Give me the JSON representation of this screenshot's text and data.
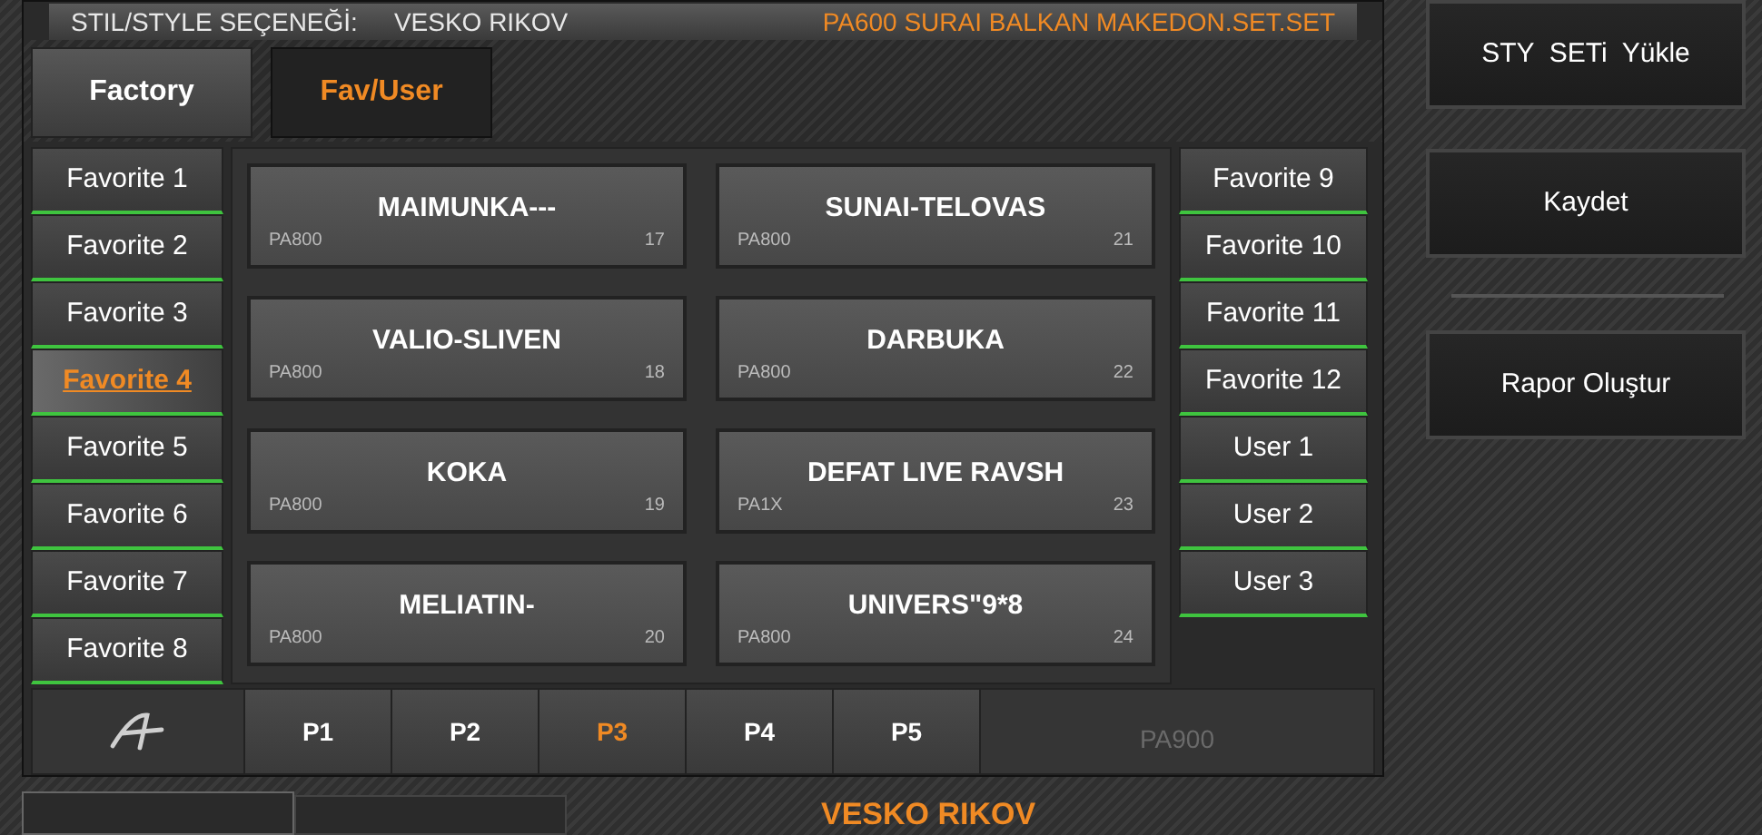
{
  "header": {
    "label": "STIL/STYLE SEÇENEĞİ:",
    "name": "VESKO RIKOV",
    "set_name": "PA600 SURAI BALKAN MAKEDON.SET.SET"
  },
  "tabs": [
    {
      "label": "Factory",
      "selected": false
    },
    {
      "label": "Fav/User",
      "selected": true
    }
  ],
  "left_banks": [
    {
      "label": "Favorite 1",
      "selected": false
    },
    {
      "label": "Favorite 2",
      "selected": false
    },
    {
      "label": "Favorite 3",
      "selected": false
    },
    {
      "label": "Favorite 4",
      "selected": true
    },
    {
      "label": "Favorite 5",
      "selected": false
    },
    {
      "label": "Favorite 6",
      "selected": false
    },
    {
      "label": "Favorite 7",
      "selected": false
    },
    {
      "label": "Favorite 8",
      "selected": false
    }
  ],
  "styles": [
    {
      "name": "MAIMUNKA---",
      "model": "PA800",
      "number": "17"
    },
    {
      "name": "SUNAI-TELOVAS",
      "model": "PA800",
      "number": "21"
    },
    {
      "name": "VALIO-SLIVEN",
      "model": "PA800",
      "number": "18"
    },
    {
      "name": "DARBUKA",
      "model": "PA800",
      "number": "22"
    },
    {
      "name": "KOKA",
      "model": "PA800",
      "number": "19"
    },
    {
      "name": "DEFAT LIVE RAVSH",
      "model": "PA1X",
      "number": "23"
    },
    {
      "name": "MELIATIN-",
      "model": "PA800",
      "number": "20"
    },
    {
      "name": "UNIVERS\"9*8",
      "model": "PA800",
      "number": "24"
    }
  ],
  "right_banks": [
    {
      "label": "Favorite 9",
      "selected": false
    },
    {
      "label": "Favorite 10",
      "selected": false
    },
    {
      "label": "Favorite 11",
      "selected": false
    },
    {
      "label": "Favorite 12",
      "selected": false
    },
    {
      "label": "User 1",
      "selected": false
    },
    {
      "label": "User 2",
      "selected": false
    },
    {
      "label": "User 3",
      "selected": false
    }
  ],
  "pages": [
    {
      "label": "P1",
      "selected": false
    },
    {
      "label": "P2",
      "selected": false
    },
    {
      "label": "P3",
      "selected": true
    },
    {
      "label": "P4",
      "selected": false
    },
    {
      "label": "P5",
      "selected": false
    }
  ],
  "model_label": "PA900",
  "side_buttons": [
    "STY  SETi  Yükle",
    "Kaydet",
    "Rapor Oluştur"
  ],
  "footer_name": "VESKO RIKOV"
}
